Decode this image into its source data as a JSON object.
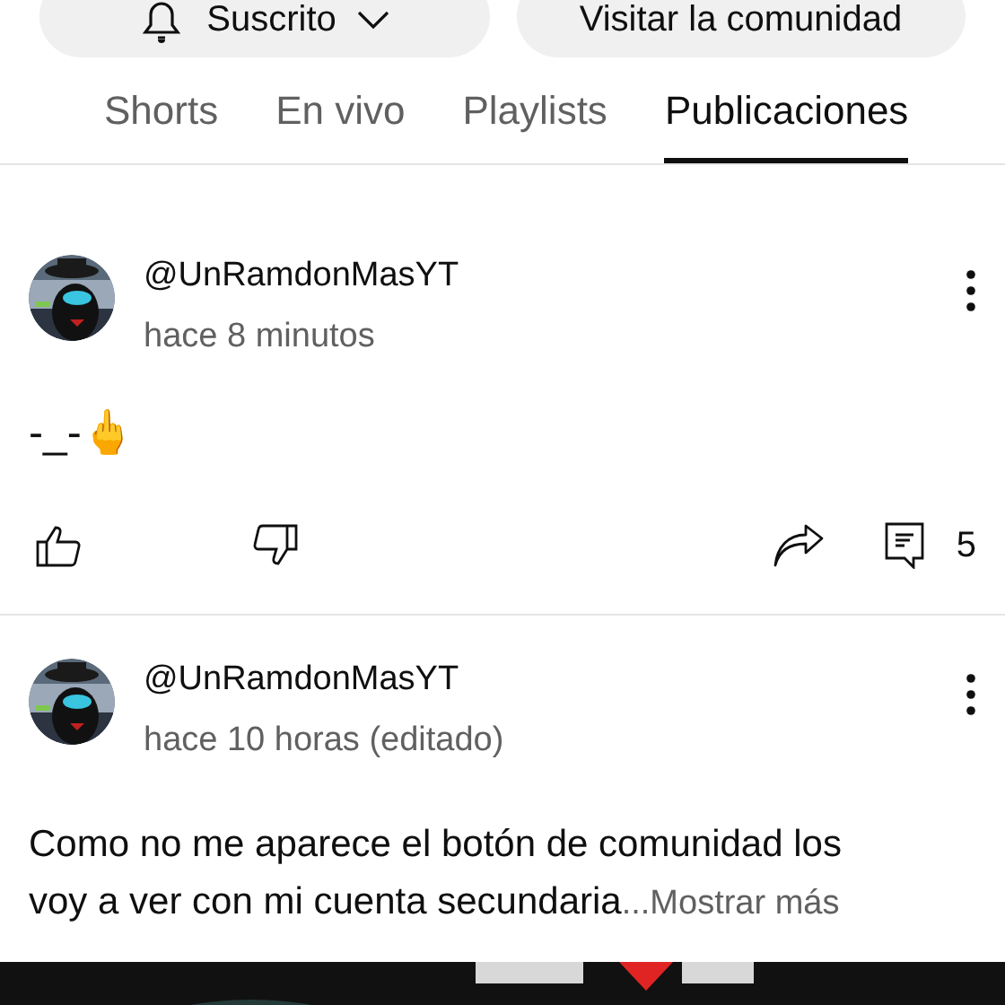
{
  "channel_buttons": [
    {
      "kind": "subscribed",
      "label": "Suscrito"
    },
    {
      "kind": "plain",
      "label": "Visitar la comunidad"
    }
  ],
  "tabs": [
    {
      "label": "Shorts",
      "selected": false
    },
    {
      "label": "En vivo",
      "selected": false
    },
    {
      "label": "Playlists",
      "selected": false
    },
    {
      "label": "Publicaciones",
      "selected": true
    }
  ],
  "posts": [
    {
      "author": "@UnRamdonMasYT",
      "time": "hace 8 minutos",
      "text": "-_-🖕",
      "comments": "5",
      "kind": "text"
    },
    {
      "author": "@UnRamdonMasYT",
      "time": "hace 10 horas (editado)",
      "text": "Como no me aparece el botón de comunidad los voy a ver con mi cuenta secundaria",
      "show_more": "...Mostrar más"
    }
  ]
}
